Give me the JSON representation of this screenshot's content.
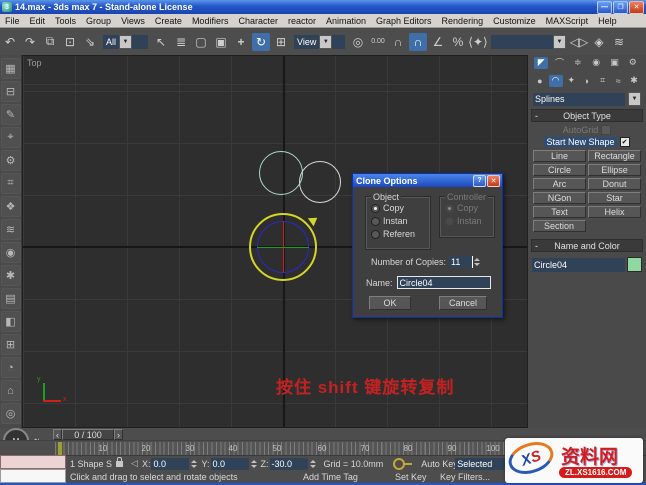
{
  "window": {
    "title": "14.max - 3ds max 7  - Stand-alone License"
  },
  "menus": [
    "File",
    "Edit",
    "Tools",
    "Group",
    "Views",
    "Create",
    "Modifiers",
    "Character",
    "reactor",
    "Animation",
    "Graph Editors",
    "Rendering",
    "Customize",
    "MAXScript",
    "Help"
  ],
  "toolbar": {
    "selection_filter": "All",
    "coord_system": "View",
    "named_selection": ""
  },
  "viewport": {
    "label": "Top",
    "annotation": "按住 shift 键旋转复制"
  },
  "clone_dialog": {
    "title": "Clone Options",
    "help": "?",
    "close": "✕",
    "object_group": {
      "label": "Object",
      "option_copy": "Copy",
      "option_instance": "Instan",
      "option_reference": "Referen"
    },
    "controller_group": {
      "label": "Controller",
      "option_copy": "Copy",
      "option_instance": "Instan"
    },
    "copies_label": "Number of Copies:",
    "copies_value": "11",
    "name_label": "Name:",
    "name_value": "Circle04",
    "ok_label": "OK",
    "cancel_label": "Cancel"
  },
  "panel": {
    "category": "Splines",
    "object_type_rollout": "Object Type",
    "autogrid_label": "AutoGrid",
    "start_new_shape_label": "Start New Shape",
    "buttons": {
      "line": "Line",
      "rectangle": "Rectangle",
      "circle": "Circle",
      "ellipse": "Ellipse",
      "arc": "Arc",
      "donut": "Donut",
      "ngon": "NGon",
      "star": "Star",
      "text": "Text",
      "helix": "Helix",
      "section": "Section"
    },
    "name_color_rollout": "Name and Color",
    "object_name": "Circle04"
  },
  "timeline": {
    "slider": "0 / 100",
    "ticks": [
      "10",
      "20",
      "30",
      "40",
      "50",
      "60",
      "70",
      "80",
      "90",
      "100"
    ]
  },
  "statusbar": {
    "selection_status": "1 Shape S",
    "x_label": "X:",
    "x_value": "0.0",
    "y_label": "Y:",
    "y_value": "0.0",
    "z_label": "Z:",
    "z_value": "-30.0",
    "grid_status": "Grid = 10.0mm",
    "prompt": "Click and drag to select and rotate objects",
    "add_time_tag": "Add Time Tag",
    "auto_key": "Auto Key",
    "set_key": "Set Key",
    "key_filters": "Key Filters...",
    "key_mode": "Selected"
  },
  "watermark": {
    "letter_x": "X",
    "letter_s": "S",
    "site_name": "资料网",
    "site_url": "ZL.XS1616.COM"
  },
  "colors": {
    "accent_blue": "#3e6fa8",
    "field_navy": "#2f4257",
    "titlebar_blue": "#2456c8",
    "selection_yellow": "#d6d62a",
    "annotation_red": "#c42222",
    "swatch_green": "#8fd8a0"
  }
}
